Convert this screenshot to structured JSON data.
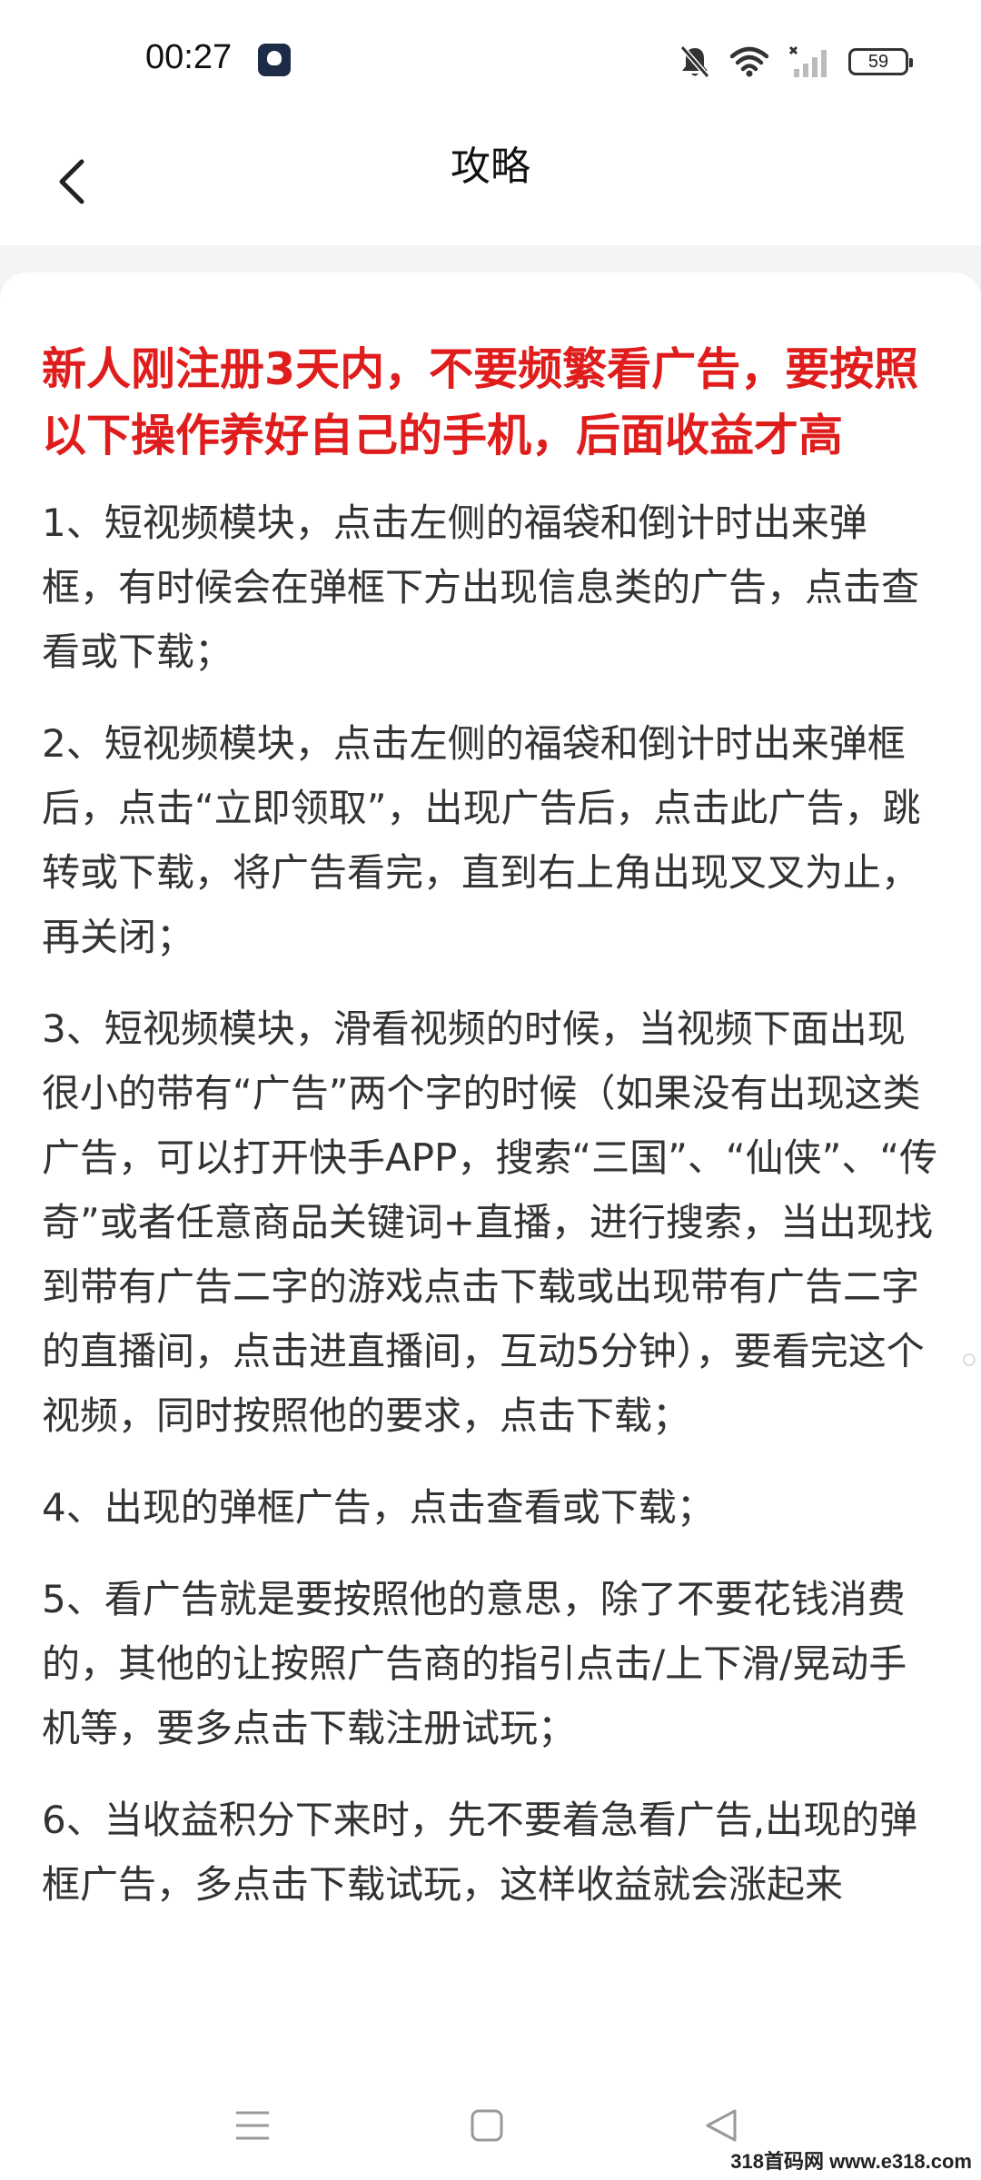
{
  "status_bar": {
    "time": "00:27",
    "battery": "59"
  },
  "header": {
    "title": "攻略"
  },
  "content": {
    "headline": "新人刚注册3天内，不要频繁看广告，要按照以下操作养好自己的手机，后面收益才高",
    "steps": [
      "1、短视频模块，点击左侧的福袋和倒计时出来弹框，有时候会在弹框下方出现信息类的广告，点击查看或下载；",
      "2、短视频模块，点击左侧的福袋和倒计时出来弹框后，点击“立即领取”，出现广告后，点击此广告，跳转或下载，将广告看完，直到右上角出现叉叉为止，再关闭；",
      "3、短视频模块，滑看视频的时候，当视频下面出现很小的带有“广告”两个字的时候（如果没有出现这类广告，可以打开快手APP，搜索“三国”、“仙侠”、“传奇”或者任意商品关键词+直播，进行搜索，当出现找到带有广告二字的游戏点击下载或出现带有广告二字的直播间，点击进直播间，互动5分钟），要看完这个视频，同时按照他的要求，点击下载；",
      "4、出现的弹框广告，点击查看或下载；",
      "5、看广告就是要按照他的意思，除了不要花钱消费的，其他的让按照广告商的指引点击/上下滑/晃动手机等，要多点击下载注册试玩；",
      "6、当收益积分下来时，先不要着急看广告,出现的弹框广告，多点击下载试玩，这样收益就会涨起来"
    ]
  },
  "watermark": "318首码网 www.e318.com",
  "colors": {
    "headline": "#e01d1d",
    "body_text": "#333333",
    "page_background": "#f4f4f4"
  }
}
